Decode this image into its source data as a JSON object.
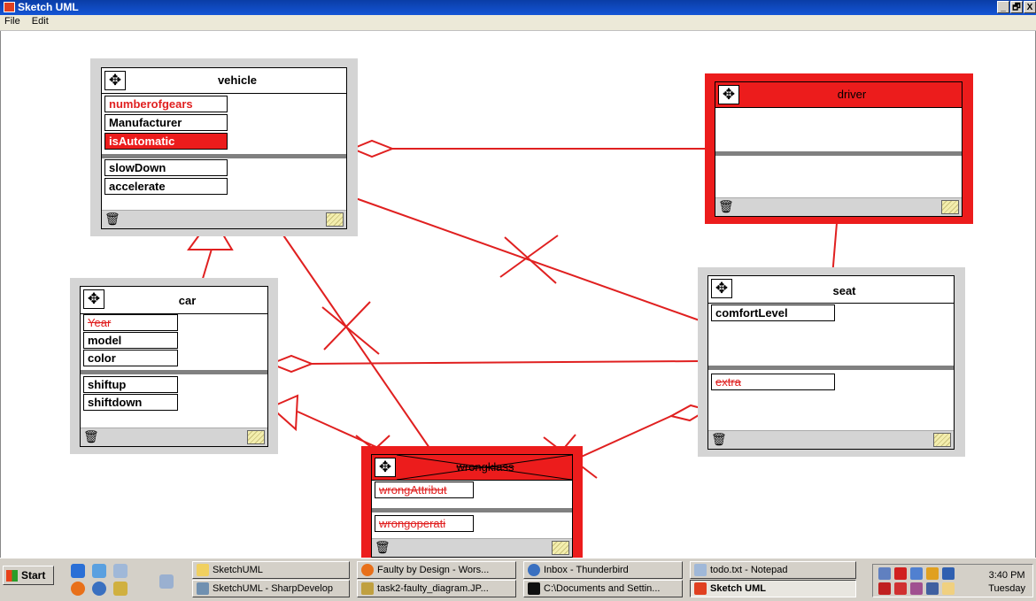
{
  "window": {
    "title": "Sketch UML",
    "controls": [
      "_",
      "🗗",
      "X"
    ]
  },
  "menu": [
    "File",
    "Edit"
  ],
  "colors": {
    "accent_red": "#ec1c1c",
    "box_gray": "#d4d4d4",
    "divider": "#808080"
  },
  "icons": {
    "move": "✥",
    "trash": "🗑"
  },
  "classes": {
    "vehicle": {
      "name": "vehicle",
      "attributes": [
        "numberofgears",
        "Manufacturer",
        "isAutomatic"
      ],
      "operations": [
        "slowDown",
        "accelerate"
      ]
    },
    "driver": {
      "name": "driver"
    },
    "car": {
      "name": "car",
      "attributes": [
        "Year",
        "model",
        "color"
      ],
      "operations": [
        "shiftup",
        "shiftdown"
      ]
    },
    "seat": {
      "name": "seat",
      "attributes": [
        "comfortLevel"
      ],
      "operations": [
        "extra"
      ]
    },
    "wrongclass": {
      "name": "wrongklass",
      "attributes": [
        "wrongAttribut"
      ],
      "operations": [
        "wrongoperati"
      ]
    }
  },
  "taskbar": {
    "start": "Start",
    "tasks": [
      "SketchUML",
      "SketchUML - SharpDevelop",
      "Faulty by Design - Wors...",
      "task2-faulty_diagram.JP...",
      "Inbox - Thunderbird",
      "C:\\Documents and Settin...",
      "todo.txt - Notepad",
      "Sketch UML"
    ],
    "clock_time": "3:40 PM",
    "clock_day": "Tuesday"
  }
}
